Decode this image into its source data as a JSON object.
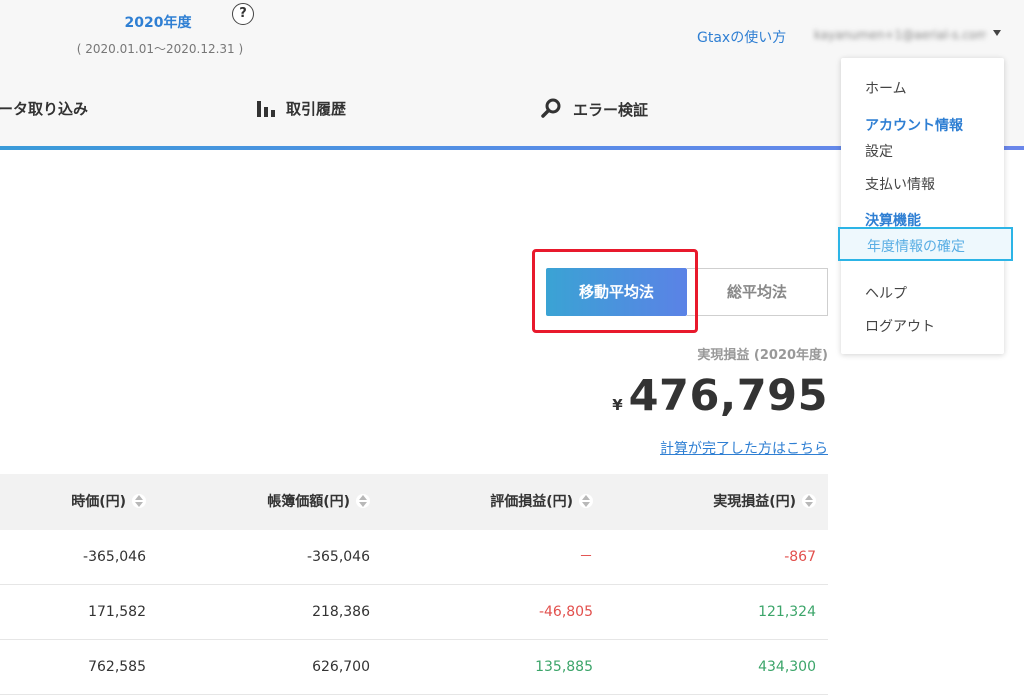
{
  "colors": {
    "accent": "#2f7fd3",
    "highlight_red": "#e8192c",
    "selected_border": "#2cb4e6",
    "negative": "#e2504d",
    "positive": "#3ca56a"
  },
  "header": {
    "year_title": "2020年度",
    "year_range": "( 2020.01.01～2020.12.31 )",
    "help_label": "?",
    "howto_link": "Gtaxの使い方",
    "account_email": "kayanumen+1@aerial-s.com"
  },
  "nav": {
    "import_label": "ータ取り込み",
    "history_label": "取引履歴",
    "history_icon": "bar-chart-icon",
    "error_label": "エラー検証",
    "error_icon": "magnifier-icon"
  },
  "dropdown": {
    "home": "ホーム",
    "account_section": "アカウント情報",
    "settings": "設定",
    "payment": "支払い情報",
    "settlement_section": "決算機能",
    "confirm_year": "年度情報の確定",
    "help": "ヘルプ",
    "logout": "ログアウト"
  },
  "method_toggle": {
    "moving_average": "移動平均法",
    "total_average": "総平均法",
    "selected": "移動平均法"
  },
  "summary": {
    "label": "実現損益 (2020年度)",
    "currency": "¥",
    "value": "476,795",
    "complete_link": "計算が完了した方はこちら"
  },
  "table": {
    "columns": [
      "時価(円)",
      "帳簿価額(円)",
      "評価損益(円)",
      "実現損益(円)"
    ],
    "rows": [
      {
        "market": "-365,046",
        "book": "-365,046",
        "unrealized": "－",
        "realized": "-867"
      },
      {
        "market": "171,582",
        "book": "218,386",
        "unrealized": "-46,805",
        "realized": "121,324"
      },
      {
        "market": "762,585",
        "book": "626,700",
        "unrealized": "135,885",
        "realized": "434,300"
      }
    ]
  }
}
